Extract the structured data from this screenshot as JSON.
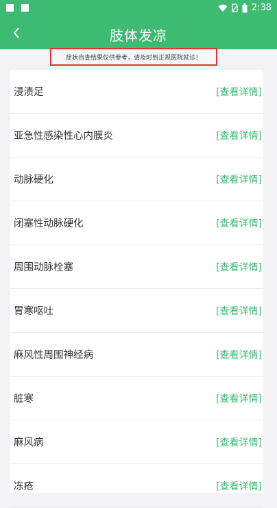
{
  "status_bar": {
    "time": "2:38"
  },
  "header": {
    "title": "肢体发凉"
  },
  "notice": "症状自查结果仅供参考，请及时到正规医院就诊！",
  "detail_label": "[查看详情]",
  "items": [
    "浸渍足",
    "亚急性感染性心内膜炎",
    "动脉硬化",
    "闭塞性动脉硬化",
    "周围动脉栓塞",
    "胃寒呕吐",
    "麻风性周围神经病",
    "脏寒",
    "麻风病",
    "冻疮"
  ],
  "colors": {
    "accent": "#3dbb73",
    "notice_border": "#e2312f"
  }
}
